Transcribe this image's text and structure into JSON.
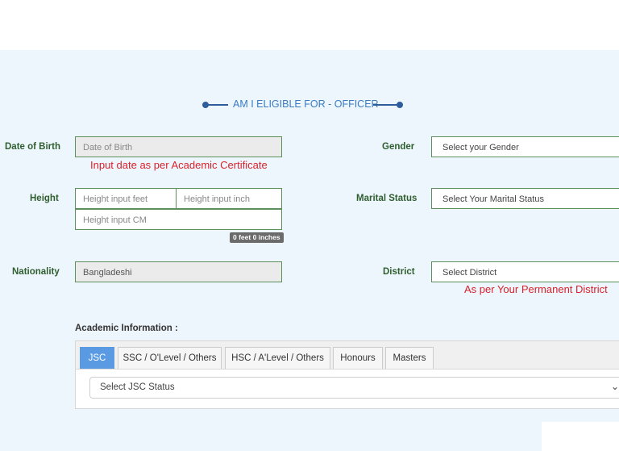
{
  "page_title": "AM I ELIGIBLE FOR - OFFICER",
  "fields": {
    "dob": {
      "label": "Date of Birth",
      "placeholder": "Date of Birth",
      "hint": "Input date as per Academic Certificate"
    },
    "gender": {
      "label": "Gender",
      "placeholder": "Select your Gender"
    },
    "height": {
      "label": "Height",
      "feet_placeholder": "Height input feet",
      "inch_placeholder": "Height input inch",
      "cm_placeholder": "Height input CM",
      "converted": "0 feet 0 inches"
    },
    "marital_status": {
      "label": "Marital Status",
      "placeholder": "Select Your Marital Status"
    },
    "nationality": {
      "label": "Nationality",
      "value": "Bangladeshi"
    },
    "district": {
      "label": "District",
      "placeholder": "Select District",
      "hint": "As per Your Permanent District"
    }
  },
  "academic": {
    "label": "Academic Information :",
    "tabs": [
      "JSC",
      "SSC / O'Level / Others",
      "HSC / A'Level / Others",
      "Honours",
      "Masters"
    ],
    "active_tab": "JSC",
    "status_select": "Select JSC Status"
  },
  "colors": {
    "title": "#3a7bc2",
    "label": "#2e5e2e",
    "hint": "#d9212a",
    "active_tab": "#5a9ae3",
    "field_border": "#5c8f5c",
    "background": "#eef6fd"
  },
  "icons": [
    "chevron-down-icon"
  ]
}
